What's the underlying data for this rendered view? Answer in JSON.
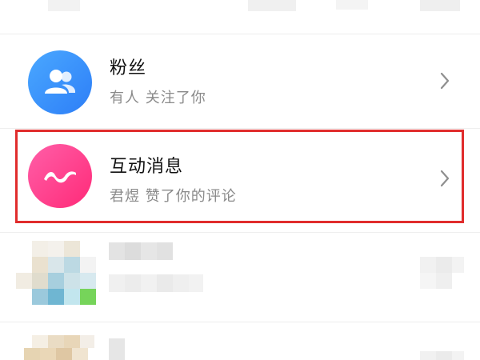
{
  "items": [
    {
      "title": "粉丝",
      "subtitle": "有人 关注了你",
      "icon": "followers-icon",
      "accent": "#3a8ef6"
    },
    {
      "title": "互动消息",
      "subtitle": "君煜 赞了你的评论",
      "icon": "interaction-icon",
      "accent": "#ff3d88"
    }
  ],
  "colors": {
    "highlight": "#e02c2c",
    "divider": "#eeeeee",
    "subtitle": "#8a8a8a"
  }
}
